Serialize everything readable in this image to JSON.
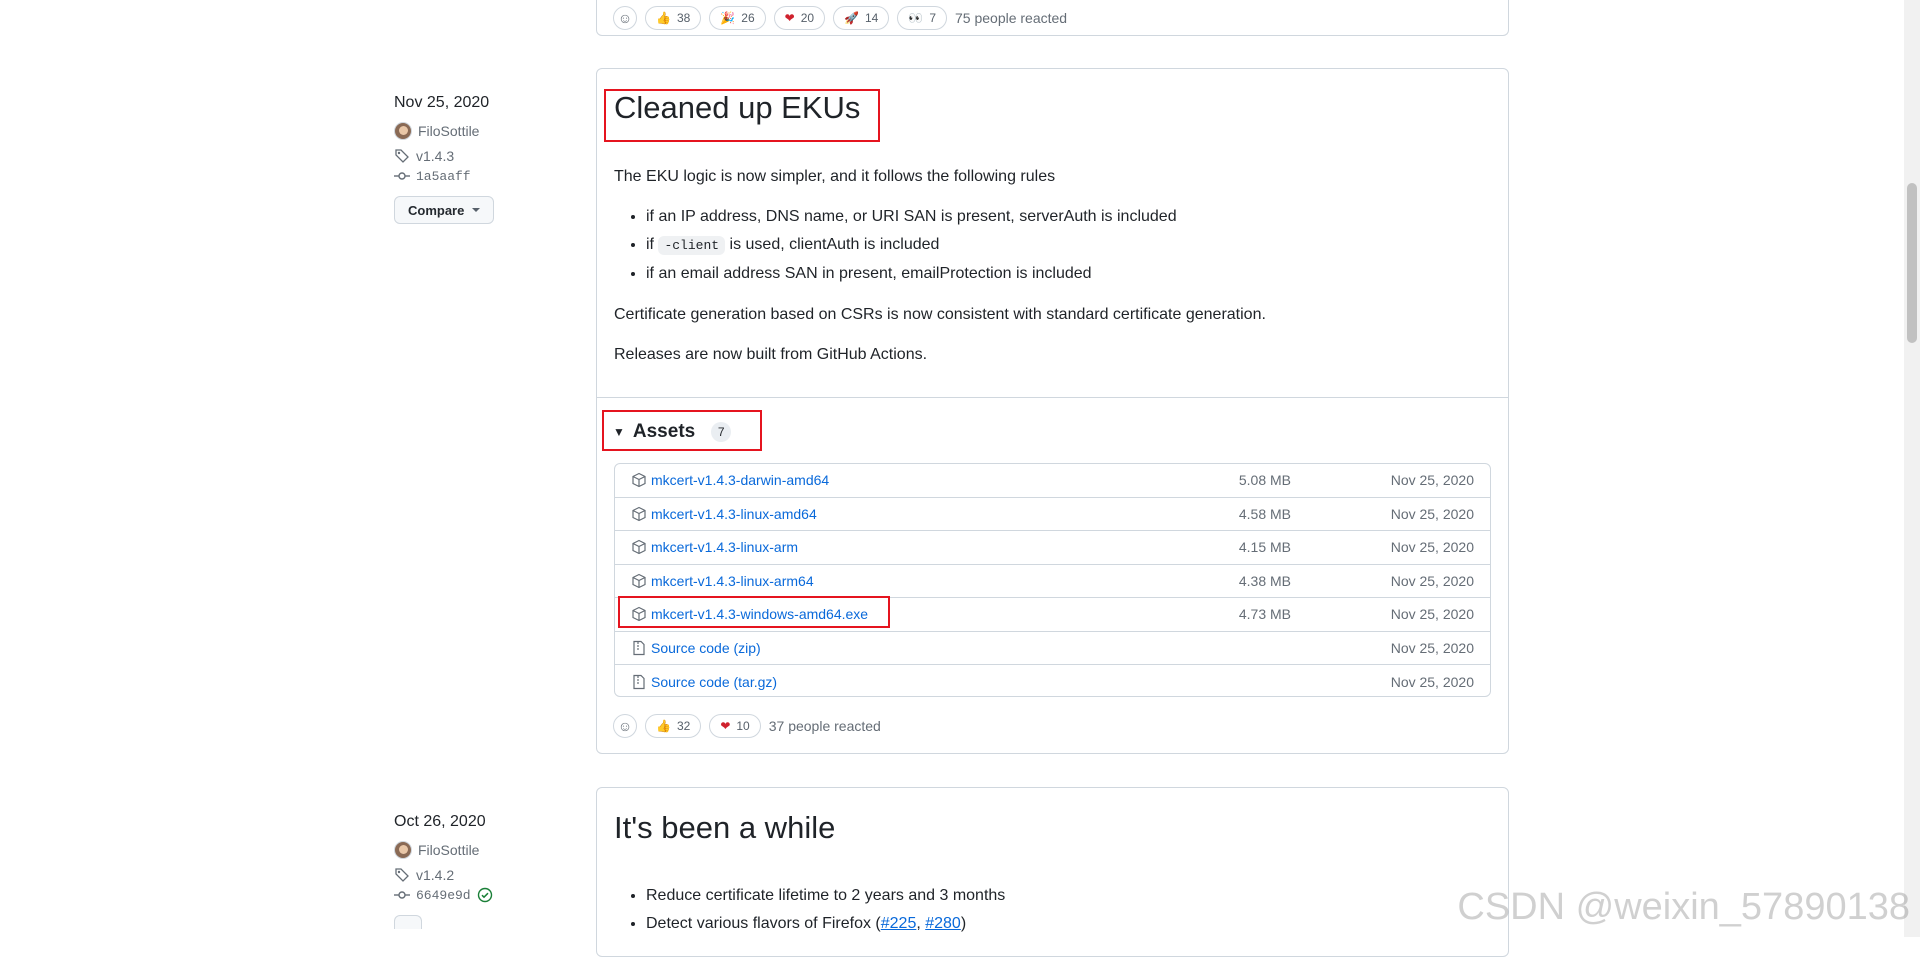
{
  "top_reactions": {
    "items": [
      {
        "emoji": "👍",
        "count": "38"
      },
      {
        "emoji": "🎉",
        "count": "26"
      },
      {
        "emoji": "❤",
        "count": "20"
      },
      {
        "emoji": "🚀",
        "count": "14"
      },
      {
        "emoji": "👀",
        "count": "7"
      }
    ],
    "summary": "75 people reacted"
  },
  "release1": {
    "date": "Nov 25, 2020",
    "author": "FiloSottile",
    "tag": "v1.4.3",
    "commit": "1a5aaff",
    "compare_label": "Compare",
    "title": "Cleaned up EKUs",
    "intro": "The EKU logic is now simpler, and it follows the following rules",
    "rule1": "if an IP address, DNS name, or URI SAN is present, serverAuth is included",
    "rule2_prefix": "if",
    "rule2_code": "-client",
    "rule2_suffix": "is used, clientAuth is included",
    "rule3": "if an email address SAN in present, emailProtection is included",
    "para1": "Certificate generation based on CSRs is now consistent with standard certificate generation.",
    "para2": "Releases are now built from GitHub Actions.",
    "assets_label": "Assets",
    "assets_count": "7",
    "assets": [
      {
        "name": "mkcert-v1.4.3-darwin-amd64",
        "size": "5.08 MB",
        "date": "Nov 25, 2020"
      },
      {
        "name": "mkcert-v1.4.3-linux-amd64",
        "size": "4.58 MB",
        "date": "Nov 25, 2020"
      },
      {
        "name": "mkcert-v1.4.3-linux-arm",
        "size": "4.15 MB",
        "date": "Nov 25, 2020"
      },
      {
        "name": "mkcert-v1.4.3-linux-arm64",
        "size": "4.38 MB",
        "date": "Nov 25, 2020"
      },
      {
        "name": "mkcert-v1.4.3-windows-amd64.exe",
        "size": "4.73 MB",
        "date": "Nov 25, 2020"
      }
    ],
    "sources": [
      {
        "name": "Source code",
        "ext": "(zip)",
        "date": "Nov 25, 2020"
      },
      {
        "name": "Source code",
        "ext": "(tar.gz)",
        "date": "Nov 25, 2020"
      }
    ],
    "reactions": [
      {
        "emoji": "👍",
        "count": "32"
      },
      {
        "emoji": "❤",
        "count": "10"
      }
    ],
    "reactions_summary": "37 people reacted"
  },
  "release2": {
    "date": "Oct 26, 2020",
    "author": "FiloSottile",
    "tag": "v1.4.2",
    "commit": "6649e9d",
    "title": "It's been a while",
    "bullet1": "Reduce certificate lifetime to 2 years and 3 months",
    "bullet2_prefix": "Detect various flavors of Firefox (",
    "bullet2_link1": "#225",
    "bullet2_sep": ", ",
    "bullet2_link2": "#280",
    "bullet2_suffix": ")"
  },
  "watermark": "CSDN @weixin_57890138",
  "colors": {
    "accent": "#0969da",
    "highlight": "#e5141f",
    "border": "#d0d7de"
  }
}
